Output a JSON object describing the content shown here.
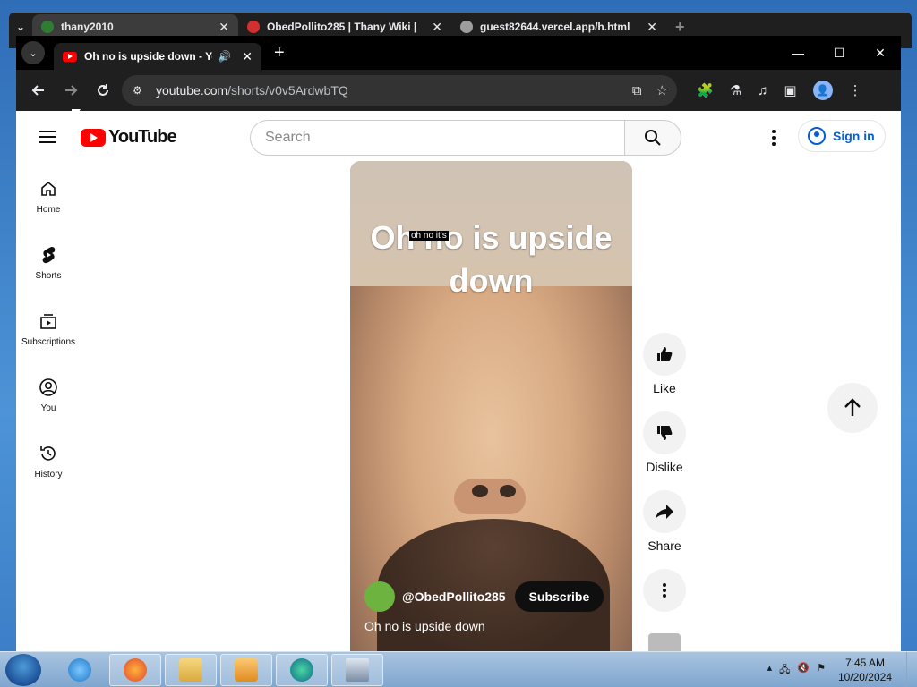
{
  "back_window": {
    "tabs": [
      {
        "title": "thany2010",
        "active": true
      },
      {
        "title": "ObedPollito285 | Thany Wiki |"
      },
      {
        "title": "guest82644.vercel.app/h.html"
      }
    ]
  },
  "browser": {
    "active_tab_title": "Oh no is upside down - YouTube",
    "omnibox": {
      "host": "youtube.com",
      "path": "/shorts/v0v5ArdwbTQ"
    }
  },
  "youtube": {
    "logo_text": "YouTube",
    "search_placeholder": "Search",
    "signin_label": "Sign in",
    "sidebar": [
      {
        "id": "home",
        "label": "Home"
      },
      {
        "id": "shorts",
        "label": "Shorts"
      },
      {
        "id": "subscriptions",
        "label": "Subscriptions"
      },
      {
        "id": "you",
        "label": "You"
      },
      {
        "id": "history",
        "label": "History"
      }
    ],
    "short": {
      "overlay_title": "Oh no is upside down",
      "caption": "oh no it's",
      "channel": "@ObedPollito285",
      "subscribe_label": "Subscribe",
      "description": "Oh no is upside down"
    },
    "actions": {
      "like": "Like",
      "dislike": "Dislike",
      "share": "Share"
    }
  },
  "taskbar": {
    "time": "7:45 AM",
    "date": "10/20/2024"
  },
  "colors": {
    "brand_red": "#ff0000",
    "link_blue": "#065fd4",
    "browser_dark": "#1f1f1f"
  }
}
